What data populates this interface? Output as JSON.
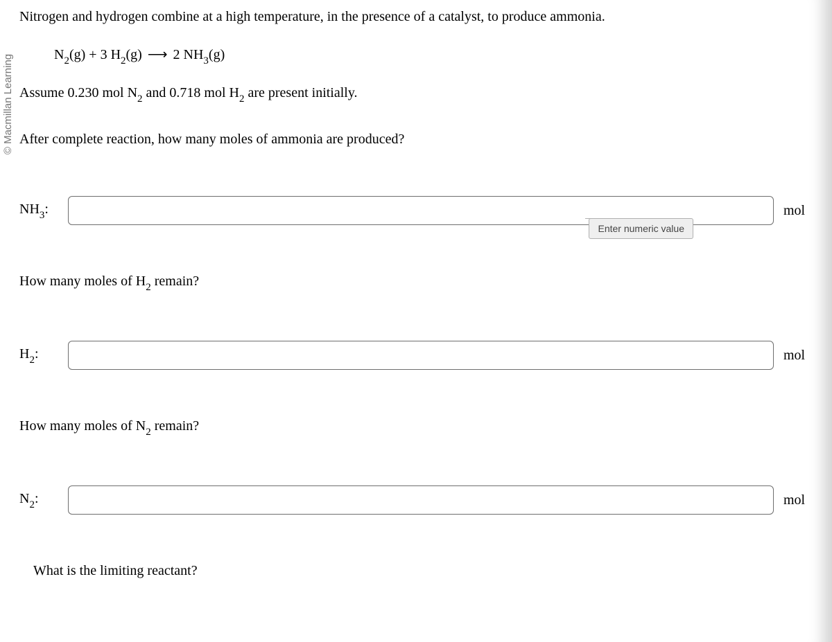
{
  "copyright": "© Macmillan Learning",
  "intro": "Nitrogen and hydrogen combine at a high temperature, in the presence of a catalyst, to produce ammonia.",
  "equation": {
    "lhs1_species": "N",
    "lhs1_sub": "2",
    "lhs1_phase": "(g)",
    "plus": " + ",
    "lhs2_coef": "3 ",
    "lhs2_species": "H",
    "lhs2_sub": "2",
    "lhs2_phase": "(g)",
    "arrow": "⟶",
    "rhs_coef": "2 ",
    "rhs_species": "NH",
    "rhs_sub": "3",
    "rhs_phase": "(g)"
  },
  "assume_pre": "Assume 0.230 mol ",
  "assume_n_species": "N",
  "assume_n_sub": "2",
  "assume_mid": " and 0.718 mol ",
  "assume_h_species": "H",
  "assume_h_sub": "2",
  "assume_post": " are present initially.",
  "q1": "After complete reaction, how many moles of ammonia are produced?",
  "ans1_species": "NH",
  "ans1_sub": "3",
  "ans1_colon": ":",
  "tooltip": "Enter numeric value",
  "unit": "mol",
  "q2_pre": "How many moles of ",
  "q2_species": "H",
  "q2_sub": "2",
  "q2_post": " remain?",
  "ans2_species": "H",
  "ans2_sub": "2",
  "ans2_colon": ":",
  "q3_pre": "How many moles of ",
  "q3_species": "N",
  "q3_sub": "2",
  "q3_post": " remain?",
  "ans3_species": "N",
  "ans3_sub": "2",
  "ans3_colon": ":",
  "q4": "What is the limiting reactant?"
}
